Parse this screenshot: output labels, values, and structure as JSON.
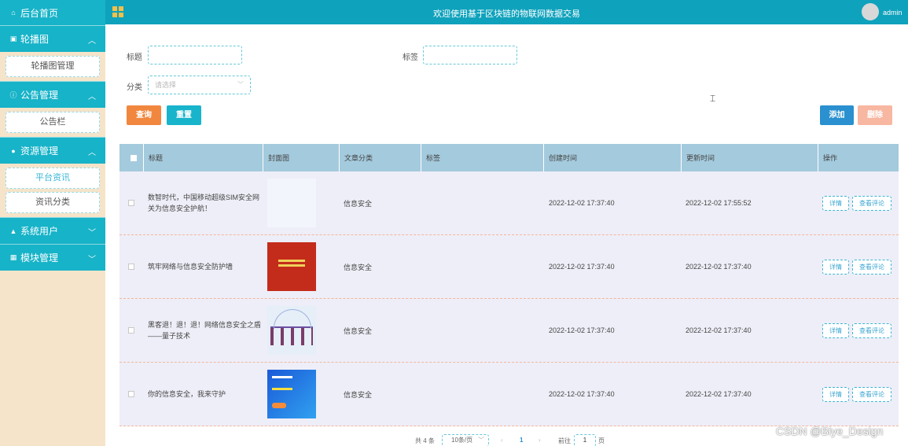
{
  "header": {
    "title": "欢迎使用基于区块链的物联网数据交易",
    "user": "admin"
  },
  "sidebar": {
    "home": "后台首页",
    "groups": [
      {
        "label": "轮播图",
        "items": [
          "轮播图管理"
        ]
      },
      {
        "label": "公告管理",
        "items": [
          "公告栏"
        ]
      },
      {
        "label": "资源管理",
        "items": [
          "平台资讯",
          "资讯分类"
        ]
      },
      {
        "label": "系统用户",
        "items": []
      },
      {
        "label": "模块管理",
        "items": []
      }
    ]
  },
  "filters": {
    "title_label": "标题",
    "tag_label": "标签",
    "category_label": "分类",
    "category_placeholder": "请选择"
  },
  "buttons": {
    "query": "查询",
    "reset": "重置",
    "add": "添加",
    "delete": "删除"
  },
  "table": {
    "headers": [
      "标题",
      "封面图",
      "文章分类",
      "标签",
      "创建时间",
      "更新时间",
      "操作"
    ],
    "rows": [
      {
        "title": "数智时代，中国移动超级SIM安全网关为信息安全护航！",
        "category": "信息安全",
        "tag": "",
        "created": "2022-12-02 17:37:40",
        "updated": "2022-12-02 17:55:52"
      },
      {
        "title": "筑牢网络与信息安全防护墙",
        "category": "信息安全",
        "tag": "",
        "created": "2022-12-02 17:37:40",
        "updated": "2022-12-02 17:37:40"
      },
      {
        "title": "黑客退！退！退！网络信息安全之盾——量子技术",
        "category": "信息安全",
        "tag": "",
        "created": "2022-12-02 17:37:40",
        "updated": "2022-12-02 17:37:40"
      },
      {
        "title": "你的信息安全，我来守护",
        "category": "信息安全",
        "tag": "",
        "created": "2022-12-02 17:37:40",
        "updated": "2022-12-02 17:37:40"
      }
    ],
    "detail_label": "详情",
    "review_label": "查看评论"
  },
  "pagination": {
    "total": "共 4 条",
    "page_size": "10条/页",
    "current_page": "1",
    "goto_label": "前往",
    "goto_value": "1",
    "page_unit": "页"
  },
  "watermark": "CSDN @Biye_Design"
}
